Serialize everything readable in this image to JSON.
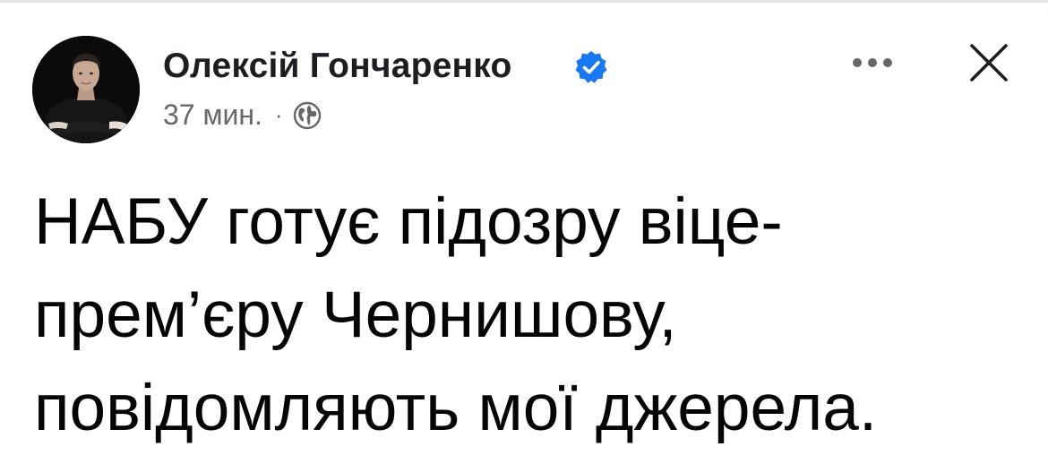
{
  "post": {
    "author": {
      "name": "Олексій Гончаренко",
      "verified": true,
      "avatar_icon": "profile-photo"
    },
    "meta": {
      "time": "37 мин.",
      "separator": "·",
      "audience_icon": "globe-icon"
    },
    "actions": {
      "more_icon": "more-horizontal-icon",
      "close_icon": "close-icon"
    },
    "text_lines": [
      "НАБУ готує підозру віце-",
      "прем’єру Чернишову,",
      "повідомляють мої джерела."
    ]
  },
  "colors": {
    "text_primary": "#050505",
    "text_secondary": "#65676b",
    "verified_blue": "#1877f2",
    "divider": "#e4e6eb"
  }
}
